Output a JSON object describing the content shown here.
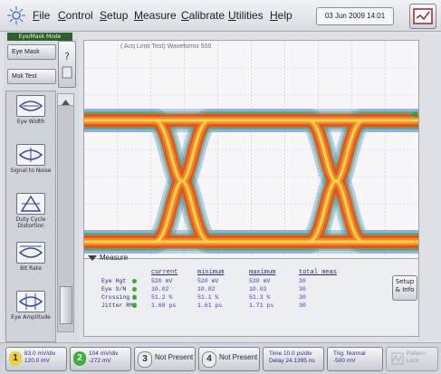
{
  "menu": {
    "items": [
      "File",
      "Control",
      "Setup",
      "Measure",
      "Calibrate",
      "Utilities",
      "Help"
    ],
    "date": "03 Jun 2009 14:01"
  },
  "left": {
    "mode_title": "Eye/Mask Mode",
    "eye_mask_button": "Eye Mask",
    "mask_test_button": "Msk Test",
    "measurements": [
      {
        "label": "Eye Width",
        "icon": "eye-width-icon"
      },
      {
        "label": "Signal to Noise",
        "icon": "signal-noise-icon"
      },
      {
        "label": "Duty Cycle Distortion",
        "icon": "duty-cycle-icon"
      },
      {
        "label": "Bit Rate",
        "icon": "bit-rate-icon"
      },
      {
        "label": "Eye Amplitude",
        "icon": "eye-amplitude-icon"
      }
    ]
  },
  "display": {
    "title": "( Acq Limit Test) Waveforms 500",
    "eye_color_hot": "#f5d24a",
    "eye_color_mid": "#e8521f",
    "eye_color_cool": "#4b7be0"
  },
  "measure_panel": {
    "tab_label": "Measure",
    "columns": [
      "current",
      "minimum",
      "maximum",
      "total meas"
    ],
    "rows": [
      {
        "name": "Eye Hgt",
        "values": [
          "520 mV",
          "520 mV",
          "520 mV",
          "30"
        ]
      },
      {
        "name": "Eye S/N",
        "values": [
          "10.02",
          "10.02",
          "10.02",
          "30"
        ]
      },
      {
        "name": "Crossing %",
        "values": [
          "51.2 %",
          "51.1 %",
          "51.3 %",
          "30"
        ]
      },
      {
        "name": "Jitter RMS",
        "values": [
          "1.68 ps",
          "1.61 ps",
          "1.71 ps",
          "30"
        ]
      }
    ],
    "setup_info": "Setup & Info"
  },
  "bottom": {
    "ch1": {
      "num": "1",
      "scale": "83.0 mV/div",
      "offset": "120.0 mV"
    },
    "ch2": {
      "num": "2",
      "scale": "104 mV/div",
      "offset": "-272 mV"
    },
    "ch3": {
      "num": "3",
      "label": "Not Present"
    },
    "ch4": {
      "num": "4",
      "label": "Not Present"
    },
    "time": {
      "scale": "Time 10.0 ps/div",
      "delay": "Delay 24.1395 ns"
    },
    "trig": {
      "mode": "Trig: Normal",
      "level": "-500 mV"
    },
    "pattern": {
      "label": "Pattern Lock"
    }
  }
}
